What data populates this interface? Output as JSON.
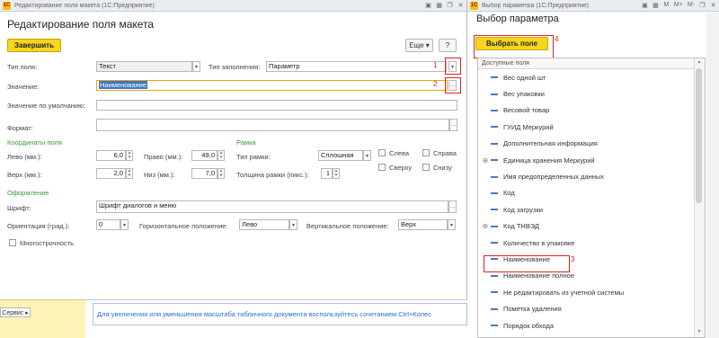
{
  "left_window": {
    "title": "Редактирование поля макета (1С:Предприятие)",
    "form_title": "Редактирование поля макета",
    "buttons": {
      "finish": "Завершить",
      "more": "Еще",
      "help": "?"
    },
    "fields": {
      "field_type_label": "Тип поля:",
      "field_type_value": "Текст",
      "fill_type_label": "Тип заполнения:",
      "fill_type_value": "Параметр",
      "value_label": "Значение:",
      "value_value": "Наименование",
      "default_value_label": "Значение по умолчанию:",
      "format_label": "Формат:"
    },
    "coords": {
      "section": "Координаты поля",
      "left_label": "Лево (мм.):",
      "left_value": "6,0",
      "right_label": "Право (мм.):",
      "right_value": "49,0",
      "top_label": "Верх (мм.):",
      "top_value": "2,0",
      "bottom_label": "Низ (мм.):",
      "bottom_value": "7,0"
    },
    "frame": {
      "section": "Рамка",
      "type_label": "Тип рамки:",
      "type_value": "Сплошная",
      "thickness_label": "Толщина рамки (пикс.):",
      "thickness_value": "1",
      "left": "Слева",
      "right": "Справа",
      "top": "Сверху",
      "bottom": "Снизу"
    },
    "design": {
      "section": "Оформление",
      "font_label": "Шрифт:",
      "font_value": "Шрифт диалогов и меню",
      "orient_label": "Ориентация (град.):",
      "orient_value": "0",
      "halign_label": "Горизонтальное положение:",
      "halign_value": "Лево",
      "valign_label": "Вертикальное положение:",
      "valign_value": "Верх",
      "multiline_label": "Многострочность"
    },
    "markers": {
      "m1": "1",
      "m2": "2"
    },
    "service_button": "Сервис ▸",
    "hint": "Для увеличения или уменьшения масштаба табличного документа воспользуйтесь сочетанием Ctrl+Колес"
  },
  "right_window": {
    "title": "Выбор параметра (1С:Предприятие)",
    "form_title": "Выбор параметра",
    "select_button": "Выбрать поле",
    "tb_icons": [
      "M",
      "M+",
      "M-"
    ],
    "list_header": "Доступные поля",
    "items": [
      {
        "label": "Вес одной шт",
        "expandable": false
      },
      {
        "label": "Вес упаковки",
        "expandable": false
      },
      {
        "label": "Весовой товар",
        "expandable": false
      },
      {
        "label": "ГУИД Меркурий",
        "expandable": false
      },
      {
        "label": "Дополнительная информация",
        "expandable": false
      },
      {
        "label": "Единица хранения Меркурий",
        "expandable": true
      },
      {
        "label": "Имя предопределенных данных",
        "expandable": false
      },
      {
        "label": "Код",
        "expandable": false
      },
      {
        "label": "Код загрузки",
        "expandable": false
      },
      {
        "label": "Код ТНВЭД",
        "expandable": true
      },
      {
        "label": "Количество в упаковке",
        "expandable": false
      },
      {
        "label": "Наименование",
        "expandable": false,
        "highlighted": true
      },
      {
        "label": "Наименование полное",
        "expandable": false
      },
      {
        "label": "Не редактировать из учетной системы",
        "expandable": false
      },
      {
        "label": "Пометка удаления",
        "expandable": false
      },
      {
        "label": "Порядок обхода",
        "expandable": false
      }
    ],
    "markers": {
      "m3": "3",
      "m4": "4"
    }
  },
  "colors": {
    "accent_yellow": "#f7d51f",
    "highlight_red": "#e02020",
    "selection_blue": "#3c76c4",
    "section_green": "#3a9a3a"
  }
}
